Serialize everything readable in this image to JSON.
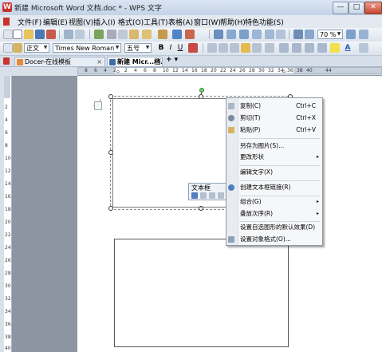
{
  "window": {
    "title": "新建 Microsoft Word 文档.doc * - WPS 文字",
    "app_icon_letter": "W",
    "minimize": "—",
    "maximize": "□",
    "close": "✕"
  },
  "menu": [
    "文件(F)",
    "编辑(E)",
    "视图(V)",
    "插入(I)",
    "格式(O)",
    "工具(T)",
    "表格(A)",
    "窗口(W)",
    "帮助(H)",
    "特色功能(S)"
  ],
  "toolbar_standard": {
    "zoom": "70 %"
  },
  "toolbar_format": {
    "style": "正文",
    "font": "Times New Roman",
    "size": "五号",
    "bold": "B",
    "italic": "I",
    "underline": "U",
    "font_color": "A"
  },
  "tabs": [
    {
      "label": "Docer-在线模板",
      "active": false
    },
    {
      "label": "新建 Micr...档.doc *",
      "active": true
    }
  ],
  "tab_new": "+ ▾",
  "ruler": {
    "h_ticks": [
      "8",
      "6",
      "4",
      "2",
      "2",
      "4",
      "6",
      "8",
      "10",
      "12",
      "14",
      "16",
      "18",
      "20",
      "22",
      "24",
      "26",
      "28",
      "30",
      "32",
      "34",
      "36",
      "38",
      "40",
      "44"
    ],
    "v_ticks": [
      "2",
      "4",
      "6",
      "8",
      "10",
      "12",
      "14",
      "16",
      "18",
      "20",
      "22",
      "24",
      "26",
      "28",
      "30",
      "32",
      "34",
      "36",
      "38",
      "40"
    ]
  },
  "floating_toolbar": {
    "title": "文本框"
  },
  "context_menu": {
    "items": [
      {
        "label": "复制(C)",
        "shortcut": "Ctrl+C",
        "icon": "copy-icon"
      },
      {
        "label": "剪切(T)",
        "shortcut": "Ctrl+X",
        "icon": "cut-icon"
      },
      {
        "label": "粘贴(P)",
        "shortcut": "Ctrl+V",
        "icon": "paste-icon"
      },
      {
        "label": "另存为图片(S)...",
        "shortcut": ""
      },
      {
        "label": "更改形状",
        "shortcut": "",
        "submenu": true
      },
      {
        "label": "编辑文字(X)",
        "shortcut": ""
      },
      {
        "label": "创建文本框链接(R)",
        "shortcut": "",
        "icon": "link-icon"
      },
      {
        "label": "组合(G)",
        "shortcut": "",
        "submenu": true
      },
      {
        "label": "叠放次序(R)",
        "shortcut": "",
        "submenu": true
      },
      {
        "label": "设置自选图形的默认效果(D)",
        "shortcut": ""
      },
      {
        "label": "设置对象格式(O)...",
        "shortcut": "",
        "icon": "format-icon"
      }
    ]
  },
  "colors": {
    "accent": "#3a6ea5",
    "menu_bg": "#f6f7f9",
    "page": "#ffffff",
    "workspace": "#8c95a1"
  }
}
